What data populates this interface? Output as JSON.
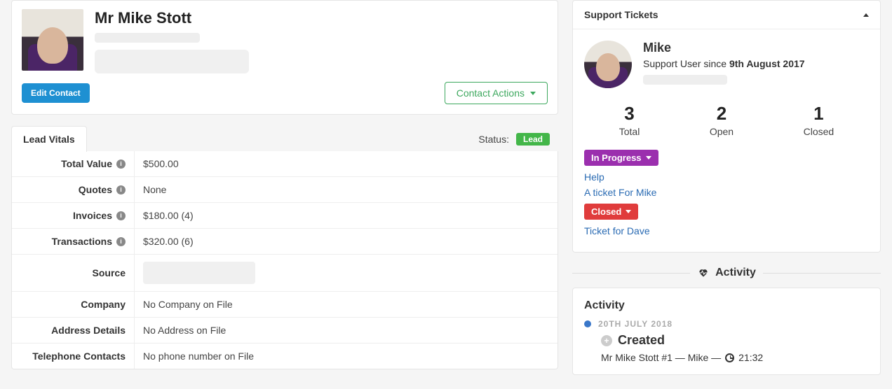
{
  "contact": {
    "name": "Mr Mike Stott",
    "edit_button": "Edit Contact",
    "actions_button": "Contact Actions"
  },
  "tabs": {
    "lead_vitals": "Lead Vitals",
    "status_label": "Status:",
    "status_value": "Lead"
  },
  "vitals": {
    "total_value": {
      "label": "Total Value",
      "value": "$500.00",
      "has_info": true
    },
    "quotes": {
      "label": "Quotes",
      "value": "None",
      "has_info": true
    },
    "invoices": {
      "label": "Invoices",
      "value": "$180.00 (4)",
      "has_info": true
    },
    "transactions": {
      "label": "Transactions",
      "value": "$320.00 (6)",
      "has_info": true
    },
    "source": {
      "label": "Source",
      "value": ""
    },
    "company": {
      "label": "Company",
      "value": "No Company on File"
    },
    "address": {
      "label": "Address Details",
      "value": "No Address on File"
    },
    "phone": {
      "label": "Telephone Contacts",
      "value": "No phone number on File"
    }
  },
  "support": {
    "panel_title": "Support Tickets",
    "name": "Mike",
    "since_prefix": "Support User since ",
    "since_date": "9th August 2017",
    "stats": {
      "total": {
        "num": "3",
        "label": "Total"
      },
      "open": {
        "num": "2",
        "label": "Open"
      },
      "closed": {
        "num": "1",
        "label": "Closed"
      }
    },
    "in_progress_label": "In Progress",
    "ticket1": "Help",
    "ticket2": "A ticket For Mike",
    "closed_label": "Closed",
    "ticket3": "Ticket for Dave"
  },
  "activity": {
    "divider_label": "Activity",
    "title": "Activity",
    "date": "20TH JULY 2018",
    "created": "Created",
    "detail_prefix": "Mr Mike Stott #1 — Mike — ",
    "time": "21:32"
  }
}
